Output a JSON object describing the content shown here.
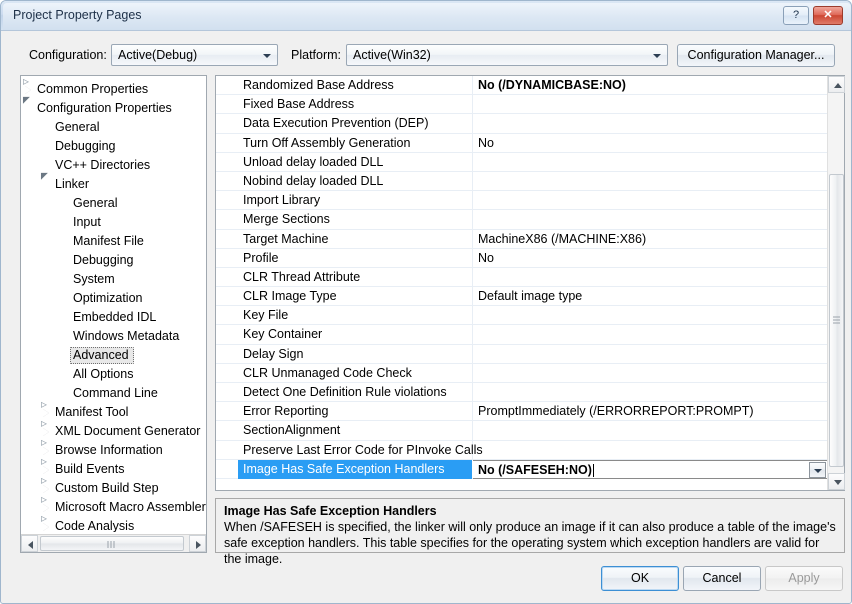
{
  "window": {
    "title": "Project Property Pages",
    "help_button": "?",
    "close_button": "✕"
  },
  "toolbar": {
    "configuration_label": "Configuration:",
    "configuration_value": "Active(Debug)",
    "platform_label": "Platform:",
    "platform_value": "Active(Win32)",
    "configuration_manager_label": "Configuration Manager..."
  },
  "tree": {
    "selected": "Advanced",
    "items": [
      {
        "label": "Common Properties",
        "indent": 0,
        "expander": "collapsed"
      },
      {
        "label": "Configuration Properties",
        "indent": 0,
        "expander": "expanded"
      },
      {
        "label": "General",
        "indent": 1,
        "expander": "none"
      },
      {
        "label": "Debugging",
        "indent": 1,
        "expander": "none"
      },
      {
        "label": "VC++ Directories",
        "indent": 1,
        "expander": "none"
      },
      {
        "label": "Linker",
        "indent": 1,
        "expander": "expanded"
      },
      {
        "label": "General",
        "indent": 2,
        "expander": "none"
      },
      {
        "label": "Input",
        "indent": 2,
        "expander": "none"
      },
      {
        "label": "Manifest File",
        "indent": 2,
        "expander": "none"
      },
      {
        "label": "Debugging",
        "indent": 2,
        "expander": "none"
      },
      {
        "label": "System",
        "indent": 2,
        "expander": "none"
      },
      {
        "label": "Optimization",
        "indent": 2,
        "expander": "none"
      },
      {
        "label": "Embedded IDL",
        "indent": 2,
        "expander": "none"
      },
      {
        "label": "Windows Metadata",
        "indent": 2,
        "expander": "none"
      },
      {
        "label": "Advanced",
        "indent": 2,
        "expander": "none"
      },
      {
        "label": "All Options",
        "indent": 2,
        "expander": "none"
      },
      {
        "label": "Command Line",
        "indent": 2,
        "expander": "none"
      },
      {
        "label": "Manifest Tool",
        "indent": 1,
        "expander": "collapsed"
      },
      {
        "label": "XML Document Generator",
        "indent": 1,
        "expander": "collapsed"
      },
      {
        "label": "Browse Information",
        "indent": 1,
        "expander": "collapsed"
      },
      {
        "label": "Build Events",
        "indent": 1,
        "expander": "collapsed"
      },
      {
        "label": "Custom Build Step",
        "indent": 1,
        "expander": "collapsed"
      },
      {
        "label": "Microsoft Macro Assembler",
        "indent": 1,
        "expander": "collapsed"
      },
      {
        "label": "Code Analysis",
        "indent": 1,
        "expander": "collapsed"
      }
    ]
  },
  "grid": {
    "rows": [
      {
        "name": "Randomized Base Address",
        "value": "No (/DYNAMICBASE:NO)",
        "bold": true,
        "selected": false
      },
      {
        "name": "Fixed Base Address",
        "value": "",
        "bold": false,
        "selected": false
      },
      {
        "name": "Data Execution Prevention (DEP)",
        "value": "",
        "bold": false,
        "selected": false
      },
      {
        "name": "Turn Off Assembly Generation",
        "value": "No",
        "bold": false,
        "selected": false
      },
      {
        "name": "Unload delay loaded DLL",
        "value": "",
        "bold": false,
        "selected": false
      },
      {
        "name": "Nobind delay loaded DLL",
        "value": "",
        "bold": false,
        "selected": false
      },
      {
        "name": "Import Library",
        "value": "",
        "bold": false,
        "selected": false
      },
      {
        "name": "Merge Sections",
        "value": "",
        "bold": false,
        "selected": false
      },
      {
        "name": "Target Machine",
        "value": "MachineX86 (/MACHINE:X86)",
        "bold": false,
        "selected": false
      },
      {
        "name": "Profile",
        "value": "No",
        "bold": false,
        "selected": false
      },
      {
        "name": "CLR Thread Attribute",
        "value": "",
        "bold": false,
        "selected": false
      },
      {
        "name": "CLR Image Type",
        "value": "Default image type",
        "bold": false,
        "selected": false
      },
      {
        "name": "Key File",
        "value": "",
        "bold": false,
        "selected": false
      },
      {
        "name": "Key Container",
        "value": "",
        "bold": false,
        "selected": false
      },
      {
        "name": "Delay Sign",
        "value": "",
        "bold": false,
        "selected": false
      },
      {
        "name": "CLR Unmanaged Code Check",
        "value": "",
        "bold": false,
        "selected": false
      },
      {
        "name": "Detect One Definition Rule violations",
        "value": "",
        "bold": false,
        "selected": false
      },
      {
        "name": "Error Reporting",
        "value": "PromptImmediately (/ERRORREPORT:PROMPT)",
        "bold": false,
        "selected": false
      },
      {
        "name": "SectionAlignment",
        "value": "",
        "bold": false,
        "selected": false
      },
      {
        "name": "Preserve Last Error Code for PInvoke Calls",
        "value": "",
        "bold": false,
        "selected": false
      },
      {
        "name": "Image Has Safe Exception Handlers",
        "value": "No (/SAFESEH:NO)",
        "bold": true,
        "selected": true
      }
    ]
  },
  "description": {
    "title": "Image Has Safe Exception Handlers",
    "body": "When /SAFESEH is specified, the linker will only produce an image if it can also produce a table of the image's safe exception handlers. This table specifies for the operating system which exception handlers are valid for the image."
  },
  "footer": {
    "ok_label": "OK",
    "cancel_label": "Cancel",
    "apply_label": "Apply"
  },
  "colors": {
    "selection_blue": "#2a9df4",
    "dialog_background": "#f0f0f0",
    "close_button_red": "#cc4632"
  }
}
